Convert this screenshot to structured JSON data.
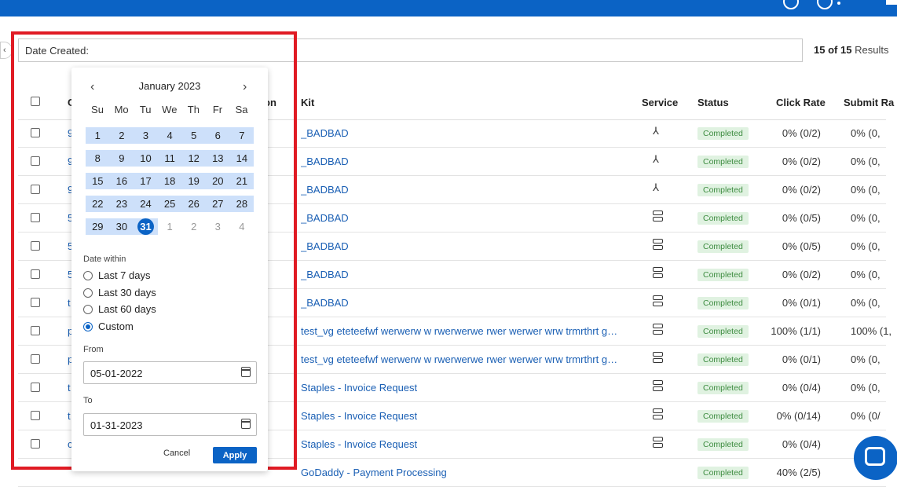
{
  "filter": {
    "label": "Date Created:"
  },
  "results": {
    "shown": "15",
    "of": "of",
    "total": "15",
    "suffix": "Results"
  },
  "table": {
    "columns": {
      "kit": "Kit",
      "service": "Service",
      "status": "Status",
      "click_rate": "Click Rate",
      "submit_rate": "Submit Ra",
      "partial_c": "C",
      "partial_on": "on"
    },
    "rows": [
      {
        "lead": "9",
        "kit": "_BADBAD",
        "service": "pin-icon",
        "status": "Completed",
        "click": "0% (0/2)",
        "submit": "0% (0,"
      },
      {
        "lead": "9",
        "kit": "_BADBAD",
        "service": "pin-icon",
        "status": "Completed",
        "click": "0% (0/2)",
        "submit": "0% (0,"
      },
      {
        "lead": "9",
        "kit": "_BADBAD",
        "service": "pin-icon",
        "status": "Completed",
        "click": "0% (0/2)",
        "submit": "0% (0,"
      },
      {
        "lead": "5",
        "kit": "_BADBAD",
        "service": "server-icon",
        "status": "Completed",
        "click": "0% (0/5)",
        "submit": "0% (0,"
      },
      {
        "lead": "5",
        "kit": "_BADBAD",
        "service": "server-icon",
        "status": "Completed",
        "click": "0% (0/5)",
        "submit": "0% (0,"
      },
      {
        "lead": "5",
        "kit": "_BADBAD",
        "service": "server-icon",
        "status": "Completed",
        "click": "0% (0/2)",
        "submit": "0% (0,"
      },
      {
        "lead": "t",
        "kit": "_BADBAD",
        "service": "server-icon",
        "status": "Completed",
        "click": "0% (0/1)",
        "submit": "0% (0,"
      },
      {
        "lead": "p",
        "kit": "test_vg eteteefwf werwerw w rwerwerwe rwer werwer wrw trmrthrt grt...",
        "service": "server-icon",
        "status": "Completed",
        "click": "100% (1/1)",
        "submit": "100% (1,"
      },
      {
        "lead": "p",
        "kit": "test_vg eteteefwf werwerw w rwerwerwe rwer werwer wrw trmrthrt grt...",
        "service": "server-icon",
        "status": "Completed",
        "click": "0% (0/1)",
        "submit": "0% (0,"
      },
      {
        "lead": "t",
        "kit": "Staples - Invoice Request",
        "service": "server-icon",
        "status": "Completed",
        "click": "0% (0/4)",
        "submit": "0% (0,"
      },
      {
        "lead": "t",
        "kit": "Staples - Invoice Request",
        "service": "server-icon",
        "status": "Completed",
        "click": "0% (0/14)",
        "submit": "0% (0/"
      },
      {
        "lead": "c",
        "kit": "Staples - Invoice Request",
        "service": "server-icon",
        "status": "Completed",
        "click": "0% (0/4)",
        "submit": ""
      }
    ],
    "partial_row": {
      "kit": "GoDaddy - Payment Processing",
      "status": "Completed",
      "click": "40% (2/5)"
    }
  },
  "picker": {
    "month": "January 2023",
    "prev": "‹",
    "next": "›",
    "weekdays": [
      "Su",
      "Mo",
      "Tu",
      "We",
      "Th",
      "Fr",
      "Sa"
    ],
    "weeks": [
      [
        "1",
        "2",
        "3",
        "4",
        "5",
        "6",
        "7"
      ],
      [
        "8",
        "9",
        "10",
        "11",
        "12",
        "13",
        "14"
      ],
      [
        "15",
        "16",
        "17",
        "18",
        "19",
        "20",
        "21"
      ],
      [
        "22",
        "23",
        "24",
        "25",
        "26",
        "27",
        "28"
      ],
      [
        "29",
        "30",
        "31",
        "1",
        "2",
        "3",
        "4"
      ]
    ],
    "selected_day": "31",
    "date_within_label": "Date within",
    "options": [
      "Last 7 days",
      "Last 30 days",
      "Last 60 days",
      "Custom"
    ],
    "selected_option": "Custom",
    "from_label": "From",
    "from_value": "05-01-2022",
    "to_label": "To",
    "to_value": "01-31-2023",
    "cancel": "Cancel",
    "apply": "Apply"
  },
  "colors": {
    "brand": "#0b63c5",
    "highlight": "#e01b24",
    "range": "#cde0fa",
    "badge_bg": "#e0f2e1",
    "badge_text": "#3d8c40",
    "link": "#1a5fb4"
  }
}
